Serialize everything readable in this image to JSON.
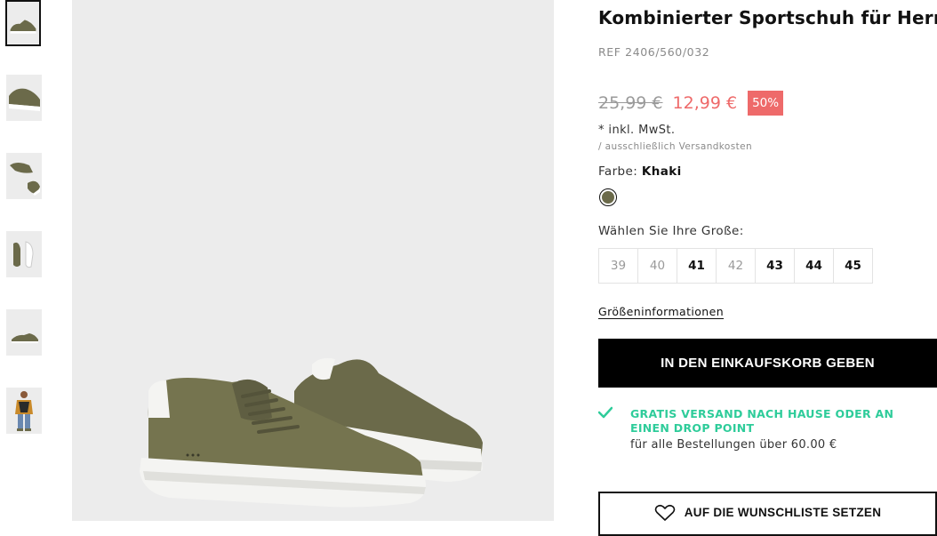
{
  "product": {
    "title": "Kombinierter Sportschuh für Herren",
    "ref": "REF 2406/560/032",
    "old_price": "25,99 €",
    "new_price": "12,99 €",
    "discount": "50%",
    "tax_note": "* inkl. MwSt.",
    "shipping_note": "/ ausschließlich Versandkosten",
    "color_label": "Farbe:",
    "color_name": "Khaki",
    "color_hex": "#6b6a4a",
    "size_label": "Wählen Sie Ihre Große:",
    "sizes": [
      {
        "label": "39",
        "available": false
      },
      {
        "label": "40",
        "available": false
      },
      {
        "label": "41",
        "available": true
      },
      {
        "label": "42",
        "available": false
      },
      {
        "label": "43",
        "available": true
      },
      {
        "label": "44",
        "available": true
      },
      {
        "label": "45",
        "available": true
      }
    ],
    "size_info_link": "Größeninformationen",
    "add_to_cart": "IN DEN EINKAUFSKORB GEBEN",
    "shipping_title": "GRATIS VERSAND NACH HAUSE ODER AN EINEN DROP POINT",
    "shipping_subtitle": "für alle Bestellungen über 60.00 €",
    "wishlist": "AUF DIE WUNSCHLISTE SETZEN"
  },
  "colors": {
    "sale": "#ee6a6a",
    "shipping_accent": "#2ecc9a",
    "button_bg": "#000000",
    "shoe": "#6b6a4a"
  },
  "icons": {
    "check": "check-icon",
    "heart": "heart-icon"
  }
}
